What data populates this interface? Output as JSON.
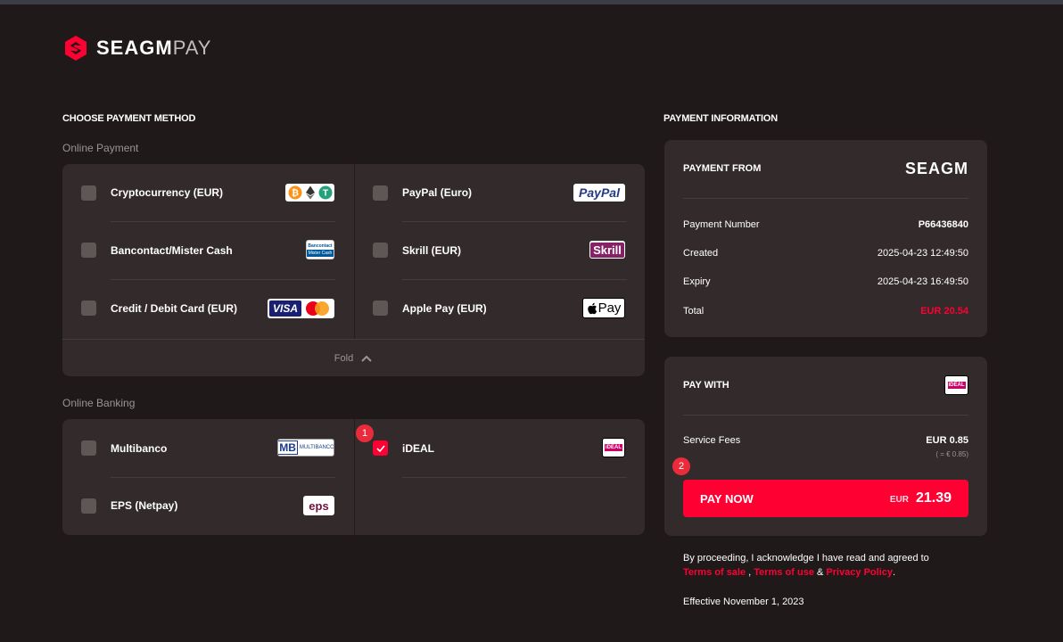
{
  "brand": {
    "name": "SEAGM",
    "suffix": "PAY",
    "pf_logo": "SEAGM"
  },
  "left": {
    "title": "CHOOSE PAYMENT METHOD",
    "online_payment": {
      "label": "Online Payment",
      "options": [
        {
          "label": "Cryptocurrency (EUR)",
          "checked": false,
          "badge": "bitcoin-ethereum-tether-icons"
        },
        {
          "label": "PayPal (Euro)",
          "checked": false,
          "badge": "paypal-logo"
        },
        {
          "label": "Bancontact/Mister Cash",
          "checked": false,
          "badge": "bancontact-logo"
        },
        {
          "label": "Skrill (EUR)",
          "checked": false,
          "badge": "skrill-logo"
        },
        {
          "label": "Credit / Debit Card (EUR)",
          "checked": false,
          "badge": "visa-mastercard-logo"
        },
        {
          "label": "Apple Pay (EUR)",
          "checked": false,
          "badge": "apple-pay-logo"
        }
      ],
      "fold_label": "Fold"
    },
    "online_banking": {
      "label": "Online Banking",
      "options": [
        {
          "label": "Multibanco",
          "checked": false,
          "badge": "multibanco-logo"
        },
        {
          "label": "iDEAL",
          "checked": true,
          "badge": "ideal-logo"
        },
        {
          "label": "EPS (Netpay)",
          "checked": false,
          "badge": "eps-logo"
        }
      ]
    }
  },
  "badges": {
    "paypal": "PayPal",
    "skrill": "Skrill",
    "visa": "VISA",
    "apple_pay": "Pay",
    "multibanco_mb": "MB",
    "multibanco_text": "MULTIBANCO",
    "ideal": "iDEAL",
    "eps": "eps",
    "bancontact_top": "Bancontact",
    "bancontact_bottom": "Mister Cash",
    "tether": "T"
  },
  "steps": {
    "one": "1",
    "two": "2"
  },
  "right": {
    "title": "PAYMENT INFORMATION",
    "payment_from": {
      "label": "PAYMENT FROM",
      "rows": [
        {
          "label": "Payment Number",
          "value": "P66436840"
        },
        {
          "label": "Created",
          "value": "2025-04-23 12:49:50"
        },
        {
          "label": "Expiry",
          "value": "2025-04-23 16:49:50"
        },
        {
          "label": "Total",
          "value": "EUR 20.54"
        }
      ]
    },
    "pay_with": {
      "label": "PAY WITH",
      "fee_label": "Service Fees",
      "fee_value": "EUR 0.85",
      "fee_sub": "( = € 0.85)",
      "button_label": "PAY NOW",
      "button_currency": "EUR",
      "button_amount": "21.39"
    },
    "legal": {
      "line1": "By proceeding, I acknowledge I have read and agreed to",
      "terms_sale": "Terms of sale",
      "sep1": " , ",
      "terms_use": "Terms of use",
      "sep2": " & ",
      "privacy": "Privacy Policy",
      "end": ".",
      "effective": "Effective November 1, 2023"
    }
  },
  "colors": {
    "accent": "#ff0032",
    "panel": "#332b2b",
    "background": "#1f1919"
  }
}
